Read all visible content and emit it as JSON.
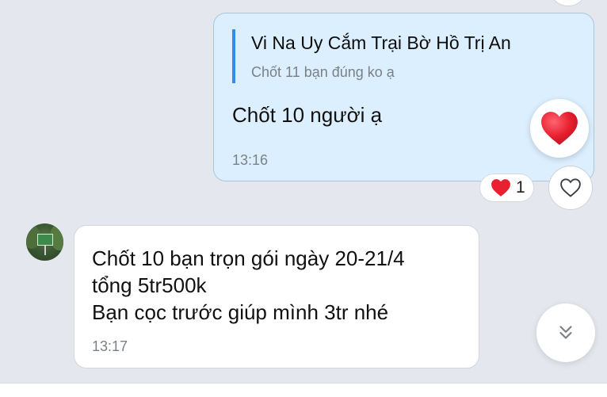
{
  "outgoing_message": {
    "quote": {
      "title": "Vi Na Uy Cắm Trại Bờ Hồ Trị An",
      "text": "Chốt 11 bạn đúng ko ạ"
    },
    "text": "Chốt 10 người ạ",
    "time": "13:16",
    "reactions": [
      {
        "icon": "heart-icon",
        "count": "1"
      }
    ]
  },
  "incoming_message": {
    "lines": [
      "Chốt 10 bạn trọn gói ngày 20-21/4",
      "tổng 5tr500k",
      "Bạn cọc trước giúp mình 3tr nhé"
    ],
    "time": "13:17"
  },
  "icons": {
    "reaction_picker": "heart-icon",
    "like": "heart-outline-icon",
    "scroll": "chevron-double-down-icon"
  },
  "colors": {
    "heart": "#e8202f",
    "quote_accent": "#2f8cf0",
    "outgoing_bubble": "#dcefff",
    "background": "#e4e7ed"
  }
}
